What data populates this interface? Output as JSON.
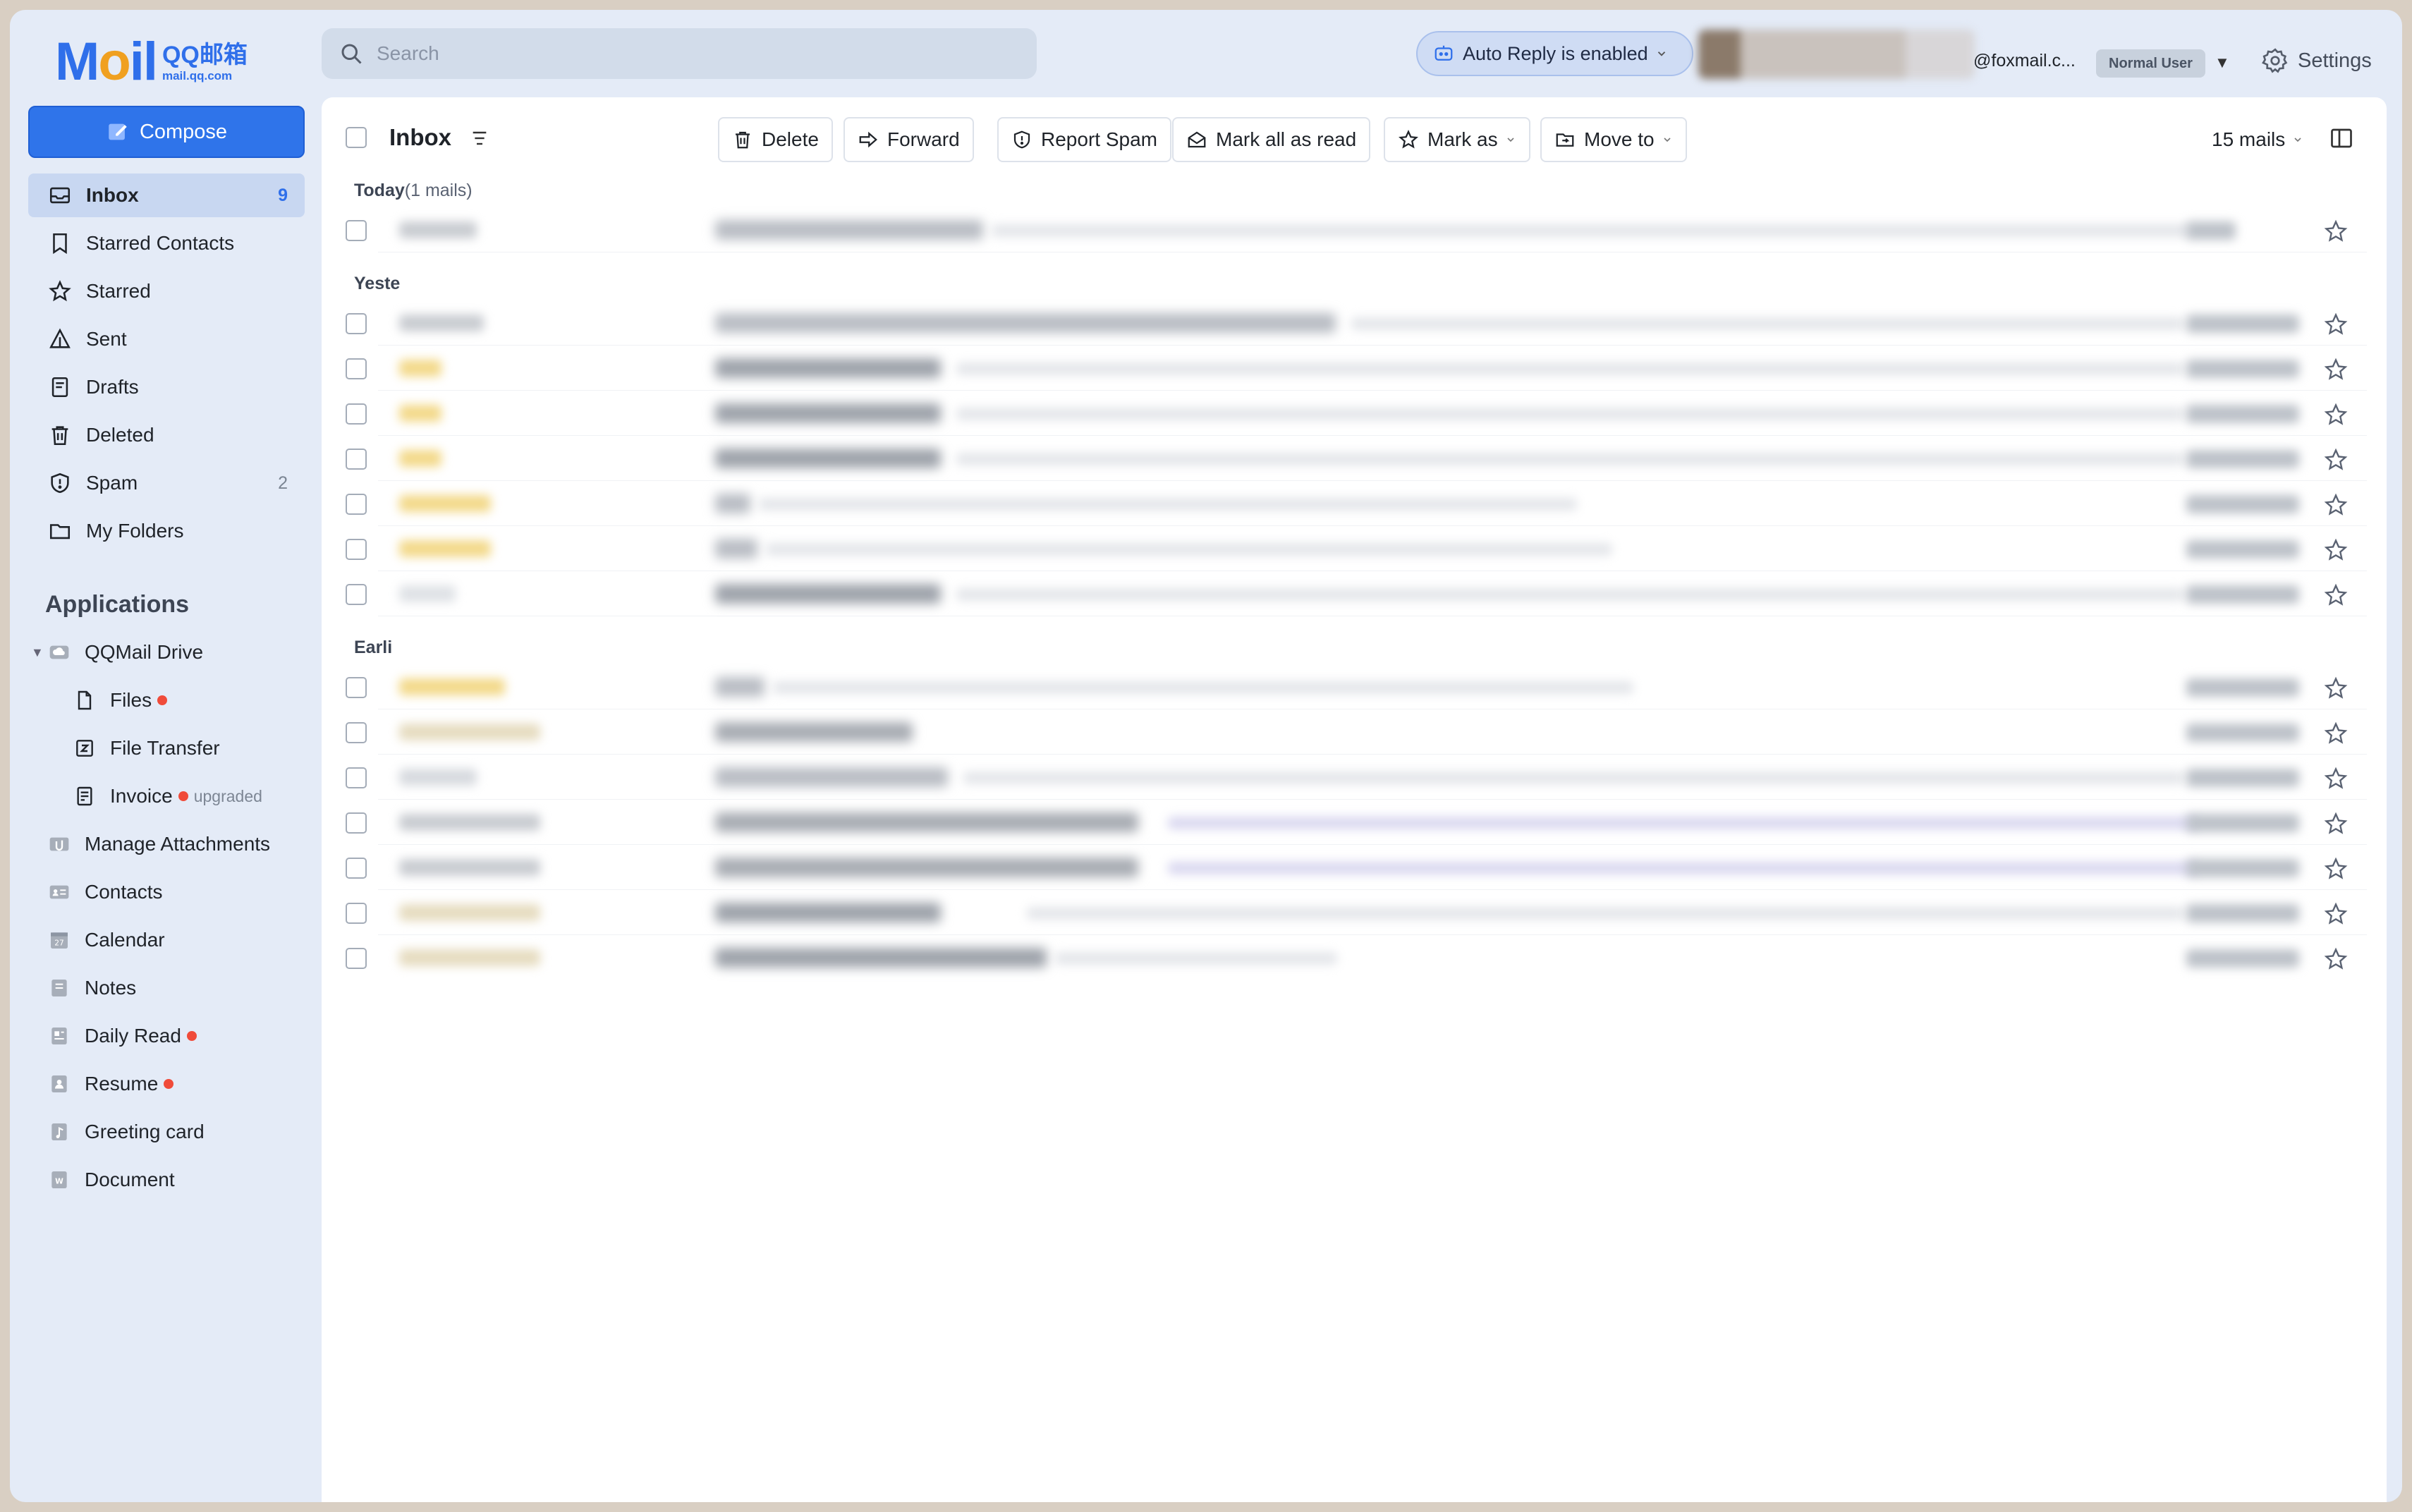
{
  "header": {
    "logo_mail": "MAIL",
    "logo_brand": "QQ邮箱",
    "logo_url": "mail.qq.com",
    "search_placeholder": "Search",
    "auto_reply_label": "Auto Reply is enabled",
    "account_email": "@foxmail.c...",
    "account_badge": "Normal User",
    "settings_label": "Settings"
  },
  "sidebar": {
    "compose_label": "Compose",
    "nav": [
      {
        "label": "Inbox",
        "count": "9",
        "icon": "inbox-icon"
      },
      {
        "label": "Starred Contacts",
        "count": "",
        "icon": "bookmark-icon"
      },
      {
        "label": "Starred",
        "count": "",
        "icon": "star-icon"
      },
      {
        "label": "Sent",
        "count": "",
        "icon": "sent-icon"
      },
      {
        "label": "Drafts",
        "count": "",
        "icon": "drafts-icon"
      },
      {
        "label": "Deleted",
        "count": "",
        "icon": "trash-icon"
      },
      {
        "label": "Spam",
        "count": "2",
        "icon": "shield-icon"
      },
      {
        "label": "My Folders",
        "count": "",
        "icon": "folder-icon"
      }
    ],
    "applications_title": "Applications",
    "apps": [
      {
        "label": "QQMail Drive",
        "icon": "cloud-drive-icon"
      },
      {
        "label": "Files",
        "icon": "file-icon"
      },
      {
        "label": "File Transfer",
        "icon": "file-transfer-icon"
      },
      {
        "label": "Invoice",
        "icon": "invoice-icon",
        "note": "upgraded"
      },
      {
        "label": "Manage Attachments",
        "icon": "attachments-icon"
      },
      {
        "label": "Contacts",
        "icon": "contacts-icon"
      },
      {
        "label": "Calendar",
        "icon": "calendar-icon"
      },
      {
        "label": "Notes",
        "icon": "notes-icon"
      },
      {
        "label": "Daily Read",
        "icon": "daily-read-icon"
      },
      {
        "label": "Resume",
        "icon": "resume-icon"
      },
      {
        "label": "Greeting card",
        "icon": "greeting-card-icon"
      },
      {
        "label": "Document",
        "icon": "document-icon"
      }
    ]
  },
  "toolbar": {
    "title": "Inbox",
    "delete_label": "Delete",
    "forward_label": "Forward",
    "report_spam_label": "Report Spam",
    "mark_all_read_label": "Mark all as read",
    "mark_as_label": "Mark as",
    "move_to_label": "Move to",
    "mail_count": "15 mails"
  },
  "mail_list": {
    "groups": [
      {
        "label": "Today",
        "count": "(1 mails)"
      },
      {
        "label": "Yeste",
        "count": ""
      },
      {
        "label": "Earli",
        "count": ""
      }
    ]
  },
  "colors": {
    "accent": "#2f74ea",
    "sidebar_bg": "#e4ebf7",
    "active_nav": "#c8d7f1",
    "badge_dot": "#f04b3a"
  }
}
